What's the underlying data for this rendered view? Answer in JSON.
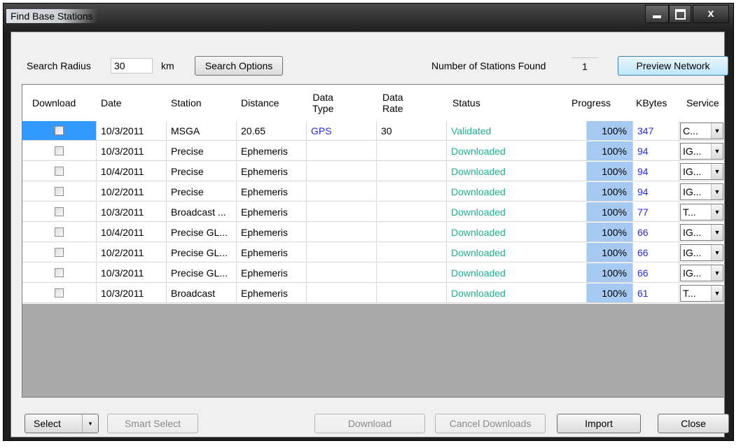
{
  "window": {
    "title": "Find Base Stations"
  },
  "titlebar_buttons": {
    "minimize_icon": "minimize-icon",
    "maximize_icon": "maximize-icon",
    "close_glyph": "x"
  },
  "search": {
    "radius_label": "Search Radius",
    "radius_value": "30",
    "unit_label": "km",
    "options_button": "Search Options",
    "found_label": "Number of Stations Found",
    "found_value": "1",
    "preview_button": "Preview Network"
  },
  "table": {
    "headers": [
      "Download",
      "Date",
      "Station",
      "Distance",
      "Data\nType",
      "Data\nRate",
      "Status",
      "Progress",
      "KBytes",
      "Service"
    ],
    "rows": [
      {
        "download": false,
        "date": "10/3/2011",
        "station": "MSGA",
        "distance": "20.65",
        "data_type": "GPS",
        "data_rate": "30",
        "status": "Validated",
        "progress": "100%",
        "kbytes": "347",
        "service": "C..."
      },
      {
        "download": false,
        "date": "10/3/2011",
        "station": "Precise",
        "distance": "Ephemeris",
        "data_type": "",
        "data_rate": "",
        "status": "Downloaded",
        "progress": "100%",
        "kbytes": "94",
        "service": "IG..."
      },
      {
        "download": false,
        "date": "10/4/2011",
        "station": "Precise",
        "distance": "Ephemeris",
        "data_type": "",
        "data_rate": "",
        "status": "Downloaded",
        "progress": "100%",
        "kbytes": "94",
        "service": "IG..."
      },
      {
        "download": false,
        "date": "10/2/2011",
        "station": "Precise",
        "distance": "Ephemeris",
        "data_type": "",
        "data_rate": "",
        "status": "Downloaded",
        "progress": "100%",
        "kbytes": "94",
        "service": "IG..."
      },
      {
        "download": false,
        "date": "10/3/2011",
        "station": "Broadcast ...",
        "distance": "Ephemeris",
        "data_type": "",
        "data_rate": "",
        "status": "Downloaded",
        "progress": "100%",
        "kbytes": "77",
        "service": "T..."
      },
      {
        "download": false,
        "date": "10/4/2011",
        "station": "Precise GL...",
        "distance": "Ephemeris",
        "data_type": "",
        "data_rate": "",
        "status": "Downloaded",
        "progress": "100%",
        "kbytes": "66",
        "service": "IG..."
      },
      {
        "download": false,
        "date": "10/2/2011",
        "station": "Precise GL...",
        "distance": "Ephemeris",
        "data_type": "",
        "data_rate": "",
        "status": "Downloaded",
        "progress": "100%",
        "kbytes": "66",
        "service": "IG..."
      },
      {
        "download": false,
        "date": "10/3/2011",
        "station": "Precise GL...",
        "distance": "Ephemeris",
        "data_type": "",
        "data_rate": "",
        "status": "Downloaded",
        "progress": "100%",
        "kbytes": "66",
        "service": "IG..."
      },
      {
        "download": false,
        "date": "10/3/2011",
        "station": "Broadcast",
        "distance": "Ephemeris",
        "data_type": "",
        "data_rate": "",
        "status": "Downloaded",
        "progress": "100%",
        "kbytes": "61",
        "service": "T..."
      }
    ]
  },
  "footer": {
    "select_button": "Select",
    "smart_select_button": "Smart Select",
    "download_button": "Download",
    "cancel_downloads_button": "Cancel Downloads",
    "import_button": "Import",
    "close_button": "Close"
  },
  "colors": {
    "link_blue": "#2a2ae0",
    "status_green": "#1fb08f",
    "progress_fill": "#a6c9f2",
    "grid_empty": "#a9a9a9"
  }
}
